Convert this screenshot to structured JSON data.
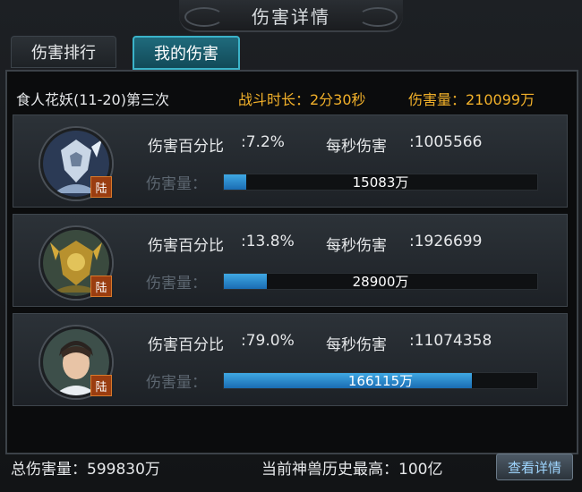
{
  "window": {
    "title": "伤害详情"
  },
  "tabs": [
    {
      "label": "伤害排行",
      "active": false
    },
    {
      "label": "我的伤害",
      "active": true
    }
  ],
  "summary": {
    "boss": "食人花妖(11-20)第三次",
    "fight_duration": "战斗时长：2分30秒",
    "damage_total": "伤害量：210099万"
  },
  "labels": {
    "percent": "伤害百分比",
    "dps": "每秒伤害",
    "amount": "伤害量："
  },
  "heroes": [
    {
      "badge": "陆",
      "percent": ":7.2%",
      "dps": ":1005566",
      "amount": "15083万",
      "fill_fraction": 0.072,
      "avatar_icon": "silver-armored-hero-portrait"
    },
    {
      "badge": "陆",
      "percent": ":13.8%",
      "dps": ":1926699",
      "amount": "28900万",
      "fill_fraction": 0.138,
      "avatar_icon": "golden-beast-hero-portrait"
    },
    {
      "badge": "陆",
      "percent": ":79.0%",
      "dps": ":11074358",
      "amount": "166115万",
      "fill_fraction": 0.79,
      "avatar_icon": "young-swordsman-portrait"
    }
  ],
  "footer": {
    "total_damage": "总伤害量：599830万",
    "record": "当前神兽历史最高：100亿",
    "detail_button": "查看详情"
  },
  "colors": {
    "accent_gold": "#f2b12a",
    "bar_blue": "#2a8fd6",
    "active_tab": "#1f6a7c"
  }
}
